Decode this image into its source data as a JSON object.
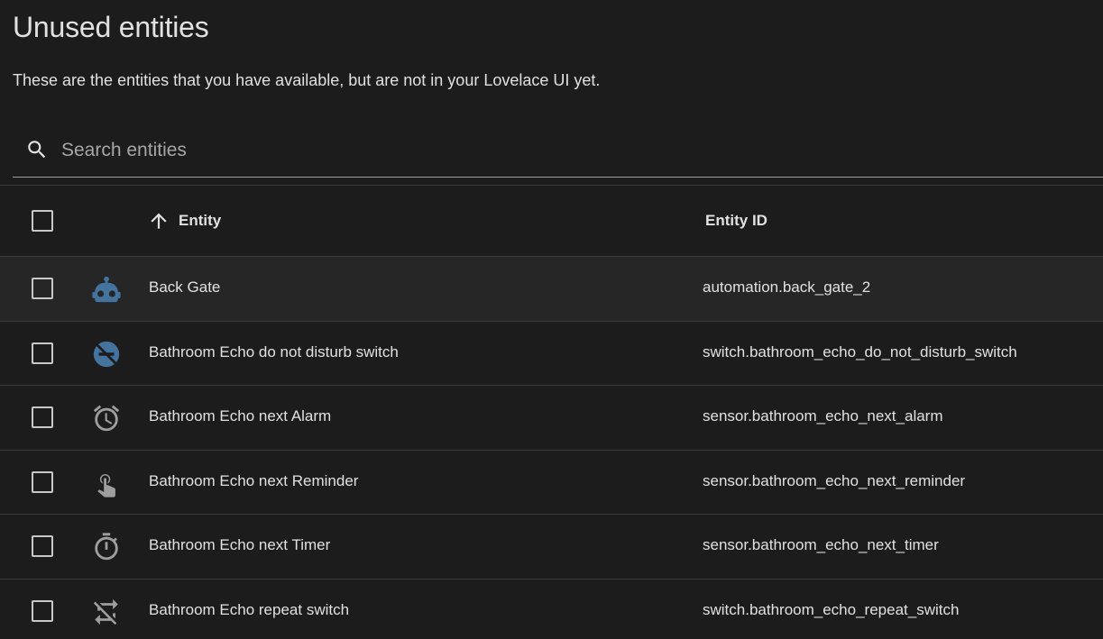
{
  "page": {
    "title": "Unused entities",
    "subtitle": "These are the entities that you have available, but are not in your Lovelace UI yet."
  },
  "search": {
    "placeholder": "Search entities",
    "value": ""
  },
  "table": {
    "columns": {
      "entity": "Entity",
      "entity_id": "Entity ID"
    },
    "sort": {
      "column": "entity",
      "direction": "ascending"
    },
    "rows": [
      {
        "name": "Back Gate",
        "entity_id": "automation.back_gate_2",
        "icon": "robot-icon",
        "icon_color": "#44739e"
      },
      {
        "name": "Bathroom Echo do not disturb switch",
        "entity_id": "switch.bathroom_echo_do_not_disturb_switch",
        "icon": "do-not-disturb-icon",
        "icon_color": "#44739e"
      },
      {
        "name": "Bathroom Echo next Alarm",
        "entity_id": "sensor.bathroom_echo_next_alarm",
        "icon": "alarm-clock-icon",
        "icon_color": "#9e9e9e"
      },
      {
        "name": "Bathroom Echo next Reminder",
        "entity_id": "sensor.bathroom_echo_next_reminder",
        "icon": "reminder-icon",
        "icon_color": "#9e9e9e"
      },
      {
        "name": "Bathroom Echo next Timer",
        "entity_id": "sensor.bathroom_echo_next_timer",
        "icon": "timer-icon",
        "icon_color": "#9e9e9e"
      },
      {
        "name": "Bathroom Echo repeat switch",
        "entity_id": "switch.bathroom_echo_repeat_switch",
        "icon": "repeat-off-icon",
        "icon_color": "#9e9e9e"
      }
    ]
  }
}
